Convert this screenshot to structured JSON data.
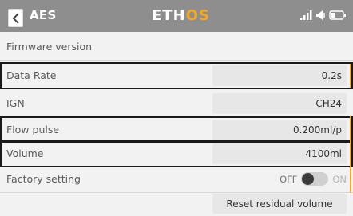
{
  "header": {
    "title": "AES",
    "logo_main": "ETH",
    "logo_accent": "OS",
    "colors": {
      "bar": "#8e8e8e",
      "accent": "#f5a623"
    },
    "status_icons": [
      "signal-icon",
      "speaker-icon",
      "battery-icon"
    ]
  },
  "rows": {
    "firmware": {
      "label": "Firmware version"
    },
    "data_rate": {
      "label": "Data Rate",
      "value": "0.2s"
    },
    "ign": {
      "label": "IGN",
      "value": "CH24"
    },
    "flow_pulse": {
      "label": "Flow pulse",
      "value": "0.200ml/p"
    },
    "volume": {
      "label": "Volume",
      "value": "4100ml"
    },
    "factory": {
      "label": "Factory setting",
      "off_label": "OFF",
      "on_label": "ON",
      "state": "off"
    }
  },
  "actions": {
    "reset": "Reset residual volume"
  }
}
